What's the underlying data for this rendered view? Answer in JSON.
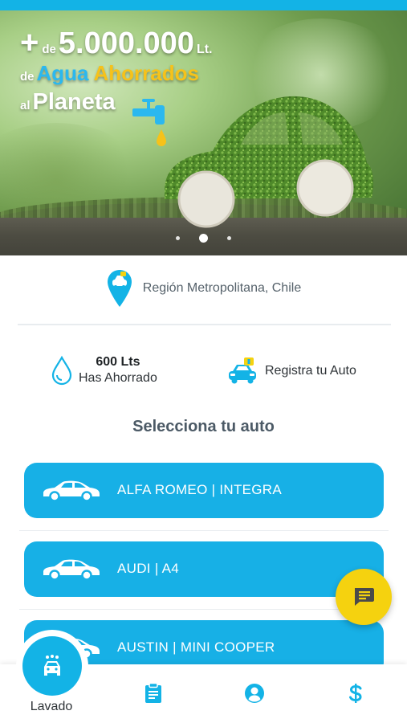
{
  "banner": {
    "plus": "+",
    "de": "de",
    "amount": "5.000.000",
    "unit": "Lt.",
    "de2": "de",
    "agua": "Agua",
    "ahorrados": "Ahorrados",
    "al": "al",
    "planeta": "Planeta",
    "slides": 3,
    "active_slide": 2
  },
  "location": {
    "text": "Región Metropolitana, Chile",
    "icon": "location-pin-car-icon"
  },
  "stats": {
    "water_value": "600 Lts",
    "water_label": "Has Ahorrado",
    "register_label": "Registra tu Auto"
  },
  "section_title": "Selecciona tu auto",
  "cars": [
    {
      "name": "ALFA ROMEO | INTEGRA"
    },
    {
      "name": "AUDI | A4"
    },
    {
      "name": "AUSTIN | MINI COOPER"
    }
  ],
  "nav": {
    "wash_label": "Lavado",
    "items": [
      {
        "icon": "clipboard-icon"
      },
      {
        "icon": "user-account-icon"
      },
      {
        "icon": "dollar-icon"
      }
    ]
  },
  "colors": {
    "primary": "#13b3e6",
    "accent": "#f5d20f",
    "title": "#4c5a66"
  }
}
